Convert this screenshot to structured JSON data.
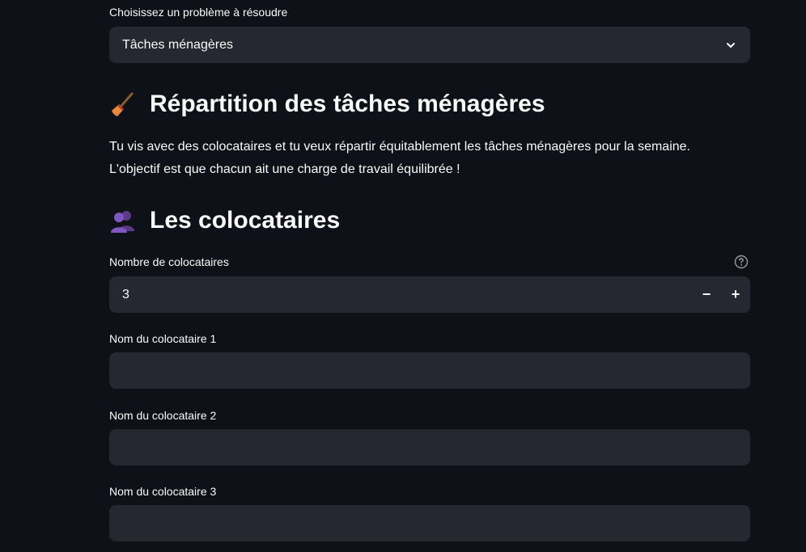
{
  "problem_select": {
    "label": "Choisissez un problème à résoudre",
    "selected": "Tâches ménagères"
  },
  "section1": {
    "title": "Répartition des tâches ménagères",
    "icon": "broom-icon",
    "intro_line1": "Tu vis avec des colocataires et tu veux répartir équitablement les tâches ménagères pour la semaine.",
    "intro_line2": "L'objectif est que chacun ait une charge de travail équilibrée !"
  },
  "section2": {
    "title": "Les colocataires",
    "icon": "two-people-icon"
  },
  "roommate_count": {
    "label": "Nombre de colocataires",
    "value": "3",
    "minus": "−",
    "plus": "+"
  },
  "roommates": [
    {
      "label": "Nom du colocataire 1",
      "value": ""
    },
    {
      "label": "Nom du colocataire 2",
      "value": ""
    },
    {
      "label": "Nom du colocataire 3",
      "value": ""
    }
  ],
  "colors": {
    "background": "#0e1117",
    "field": "#262730",
    "text": "#fafafa"
  }
}
